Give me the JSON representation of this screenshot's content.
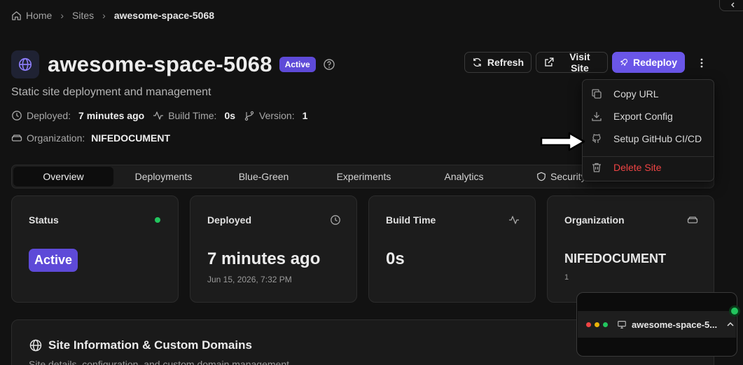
{
  "breadcrumb": {
    "home": "Home",
    "sites": "Sites",
    "current": "awesome-space-5068"
  },
  "header": {
    "title": "awesome-space-5068",
    "status_badge": "Active",
    "subtitle": "Static site deployment and management",
    "deployed_label": "Deployed:",
    "deployed_value": "7 minutes ago",
    "build_time_label": "Build Time:",
    "build_time_value": "0s",
    "version_label": "Version:",
    "version_value": "1",
    "org_label": "Organization:",
    "org_value": "NIFEDOCUMENT"
  },
  "actions": {
    "refresh": "Refresh",
    "visit_site": "Visit Site",
    "redeploy": "Redeploy"
  },
  "dropdown": {
    "copy_url": "Copy URL",
    "export_config": "Export Config",
    "setup_github": "Setup GitHub CI/CD",
    "delete_site": "Delete Site"
  },
  "tabs": [
    "Overview",
    "Deployments",
    "Blue-Green",
    "Experiments",
    "Analytics",
    "Security"
  ],
  "cards": {
    "status": {
      "label": "Status",
      "value": "Active"
    },
    "deployed": {
      "label": "Deployed",
      "value": "7 minutes ago",
      "sub": "Jun 15, 2026, 7:32 PM"
    },
    "build_time": {
      "label": "Build Time",
      "value": "0s"
    },
    "organization": {
      "label": "Organization",
      "value": "NIFEDOCUMENT",
      "sub": "1"
    }
  },
  "info_panel": {
    "title": "Site Information & Custom Domains",
    "description": "Site details, configuration, and custom domain management"
  },
  "mini_window": {
    "title": "awesome-space-5..."
  },
  "colors": {
    "accent": "#6a56e8",
    "success": "#22c55e",
    "danger": "#ef4444",
    "background": "#121212"
  }
}
